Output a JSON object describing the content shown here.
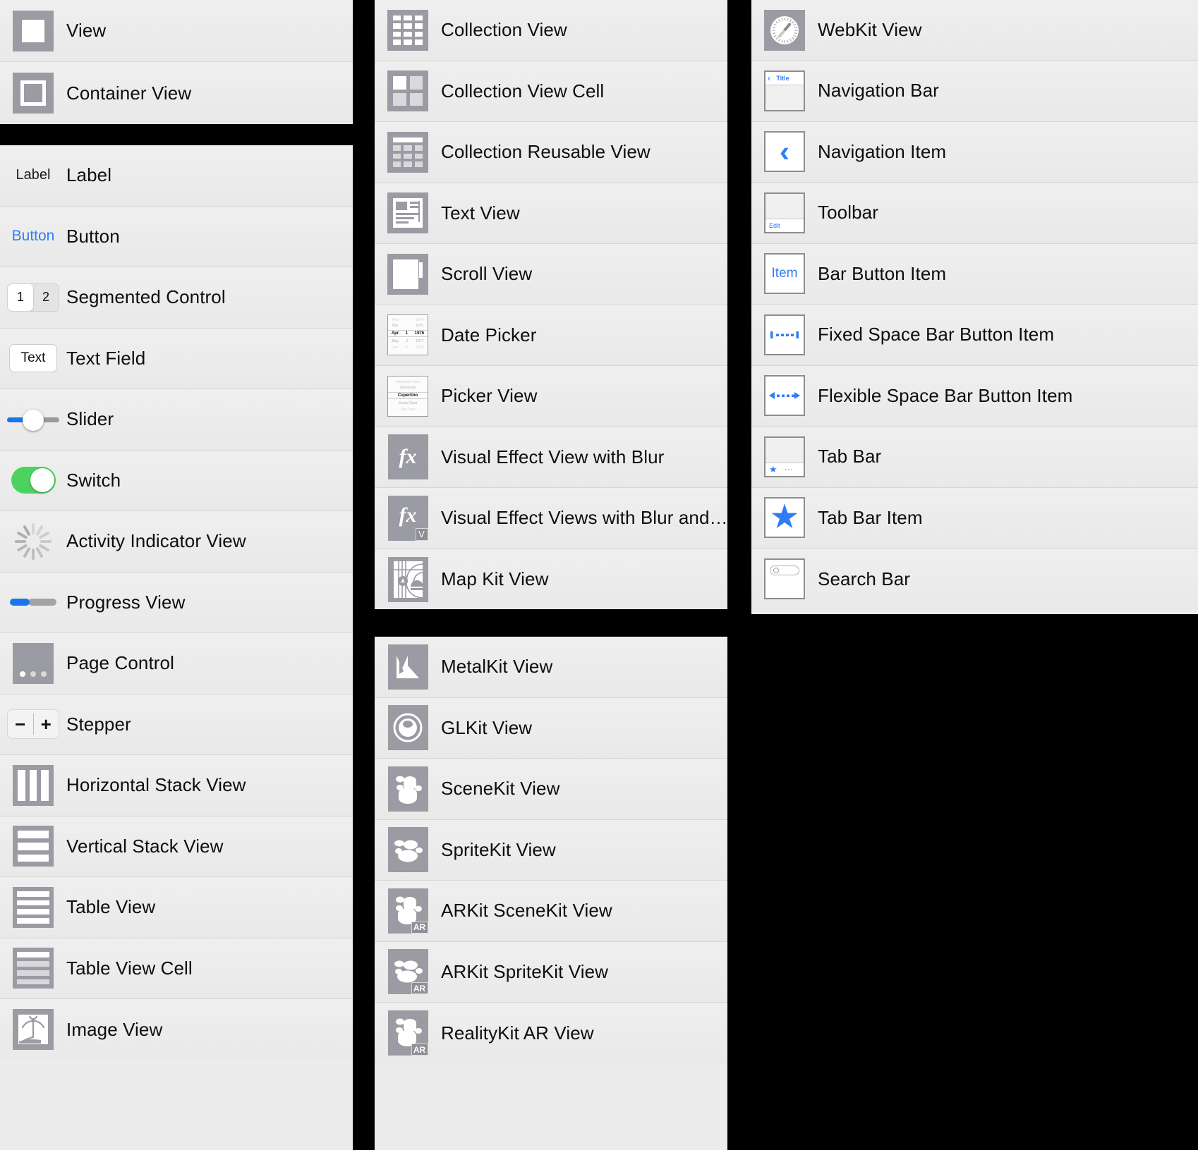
{
  "meta": {
    "background_color": "#000000",
    "panel_background": "#ececec",
    "row_divider_color": "#d6d6d6",
    "accent_blue": "#2f7cf6",
    "switch_green": "#4cd35f",
    "icon_grey": "#9b9ba3",
    "text_color": "#0d0d0d"
  },
  "panels": [
    {
      "id": "panel-views-top",
      "name": "views-panel-top",
      "rows": [
        {
          "label": "View",
          "icon": "view-icon"
        },
        {
          "label": "Container View",
          "icon": "container-view-icon"
        }
      ]
    },
    {
      "id": "panel-controls",
      "name": "controls-panel",
      "rows": [
        {
          "label": "Label",
          "icon": "label-icon",
          "icon_text": "Label"
        },
        {
          "label": "Button",
          "icon": "button-icon",
          "icon_text": "Button"
        },
        {
          "label": "Segmented Control",
          "icon": "segmented-control-icon",
          "segments": [
            "1",
            "2"
          ],
          "selected_segment": "1"
        },
        {
          "label": "Text Field",
          "icon": "text-field-icon",
          "icon_text": "Text"
        },
        {
          "label": "Slider",
          "icon": "slider-icon"
        },
        {
          "label": "Switch",
          "icon": "switch-icon"
        },
        {
          "label": "Activity Indicator View",
          "icon": "activity-indicator-icon"
        },
        {
          "label": "Progress View",
          "icon": "progress-view-icon"
        },
        {
          "label": "Page Control",
          "icon": "page-control-icon"
        },
        {
          "label": "Stepper",
          "icon": "stepper-icon",
          "minus": "−",
          "plus": "+"
        },
        {
          "label": "Horizontal Stack View",
          "icon": "horizontal-stack-view-icon"
        },
        {
          "label": "Vertical Stack View",
          "icon": "vertical-stack-view-icon"
        },
        {
          "label": "Table View",
          "icon": "table-view-icon"
        },
        {
          "label": "Table View Cell",
          "icon": "table-view-cell-icon"
        },
        {
          "label": "Image View",
          "icon": "image-view-icon"
        }
      ]
    },
    {
      "id": "panel-collections",
      "name": "collection-views-panel",
      "rows": [
        {
          "label": "Collection View",
          "icon": "collection-view-icon"
        },
        {
          "label": "Collection View Cell",
          "icon": "collection-view-cell-icon"
        },
        {
          "label": "Collection Reusable View",
          "icon": "collection-reusable-view-icon"
        },
        {
          "label": "Text View",
          "icon": "text-view-icon"
        },
        {
          "label": "Scroll View",
          "icon": "scroll-view-icon"
        },
        {
          "label": "Date Picker",
          "icon": "date-picker-icon",
          "picker_rows": [
            [
              "Feb",
              "",
              "1974"
            ],
            [
              "Mar",
              "",
              "1975"
            ],
            [
              "Apr",
              "1",
              "1976"
            ],
            [
              "May",
              "2",
              "1977"
            ],
            [
              "Jun",
              "3",
              "1978"
            ]
          ],
          "selected_picker_row": 2
        },
        {
          "label": "Picker View",
          "icon": "picker-view-icon",
          "picker_rows": [
            [
              "Mountain View"
            ],
            [
              "Sunnyvale"
            ],
            [
              "Cupertino"
            ],
            [
              "Santa Clara"
            ],
            [
              "San Jose"
            ]
          ],
          "selected_picker_row": 2
        },
        {
          "label": "Visual Effect View with Blur",
          "icon": "visual-effect-view-icon",
          "icon_text": "fx"
        },
        {
          "label": "Visual Effect Views with Blur and…",
          "icon": "visual-effect-views-vibrancy-icon",
          "icon_text": "fx",
          "badge": "V"
        },
        {
          "label": "Map Kit View",
          "icon": "map-kit-view-icon"
        }
      ]
    },
    {
      "id": "panel-kits",
      "name": "graphics-kits-panel",
      "rows": [
        {
          "label": "MetalKit View",
          "icon": "metalkit-view-icon"
        },
        {
          "label": "GLKit View",
          "icon": "glkit-view-icon"
        },
        {
          "label": "SceneKit View",
          "icon": "scenekit-view-icon"
        },
        {
          "label": "SpriteKit View",
          "icon": "spritekit-view-icon"
        },
        {
          "label": "ARKit SceneKit View",
          "icon": "arkit-scenekit-view-icon",
          "badge": "AR"
        },
        {
          "label": "ARKit SpriteKit View",
          "icon": "arkit-spritekit-view-icon",
          "badge": "AR"
        },
        {
          "label": "RealityKit AR View",
          "icon": "realitykit-ar-view-icon",
          "badge": "AR"
        }
      ]
    },
    {
      "id": "panel-bars",
      "name": "bars-panel",
      "rows": [
        {
          "label": "WebKit View",
          "icon": "webkit-view-icon"
        },
        {
          "label": "Navigation Bar",
          "icon": "navigation-bar-icon",
          "icon_text": "Title"
        },
        {
          "label": "Navigation Item",
          "icon": "navigation-item-icon"
        },
        {
          "label": "Toolbar",
          "icon": "toolbar-icon",
          "icon_text": "Edit"
        },
        {
          "label": "Bar Button Item",
          "icon": "bar-button-item-icon",
          "icon_text": "Item"
        },
        {
          "label": "Fixed Space Bar Button Item",
          "icon": "fixed-space-bar-button-item-icon"
        },
        {
          "label": "Flexible Space Bar Button Item",
          "icon": "flexible-space-bar-button-item-icon"
        },
        {
          "label": "Tab Bar",
          "icon": "tab-bar-icon"
        },
        {
          "label": "Tab Bar Item",
          "icon": "tab-bar-item-icon"
        },
        {
          "label": "Search Bar",
          "icon": "search-bar-icon"
        }
      ]
    }
  ]
}
